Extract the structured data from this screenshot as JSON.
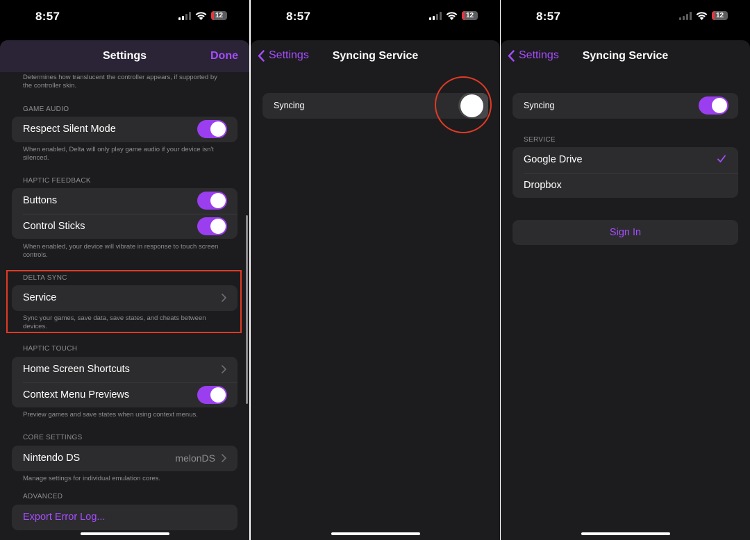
{
  "status": {
    "time": "8:57",
    "battery": "12"
  },
  "settings": {
    "title": "Settings",
    "done": "Done",
    "top_footer": "Determines how translucent the controller appears, if supported by the controller skin.",
    "sections": [
      {
        "label": "GAME AUDIO",
        "rows": [
          {
            "label": "Respect Silent Mode",
            "toggle": true
          }
        ],
        "footer": "When enabled, Delta will only play game audio if your device isn't silenced."
      },
      {
        "label": "HAPTIC FEEDBACK",
        "rows": [
          {
            "label": "Buttons",
            "toggle": true
          },
          {
            "label": "Control Sticks",
            "toggle": true
          }
        ],
        "footer": "When enabled, your device will vibrate in response to touch screen controls."
      },
      {
        "label": "DELTA SYNC",
        "rows": [
          {
            "label": "Service"
          }
        ],
        "footer": "Sync your games, save data, save states, and cheats between devices."
      },
      {
        "label": "HAPTIC TOUCH",
        "rows": [
          {
            "label": "Home Screen Shortcuts"
          },
          {
            "label": "Context Menu Previews",
            "toggle": true
          }
        ],
        "footer": "Preview games and save states when using context menus."
      },
      {
        "label": "CORE SETTINGS",
        "rows": [
          {
            "label": "Nintendo DS",
            "detail": "melonDS"
          }
        ],
        "footer": "Manage settings for individual emulation cores."
      },
      {
        "label": "ADVANCED",
        "rows": [
          {
            "label": "Export Error Log..."
          }
        ]
      }
    ]
  },
  "syncing_off": {
    "back": "Settings",
    "title": "Syncing Service",
    "syncing_label": "Syncing",
    "syncing_on": false
  },
  "syncing_on": {
    "back": "Settings",
    "title": "Syncing Service",
    "syncing_label": "Syncing",
    "syncing_on": true,
    "service_label": "SERVICE",
    "services": [
      {
        "label": "Google Drive",
        "selected": true
      },
      {
        "label": "Dropbox",
        "selected": false
      }
    ],
    "sign_in": "Sign In"
  },
  "colors": {
    "accent": "#a64dff",
    "highlight": "#e13a24",
    "background": "#000000",
    "cell": "#2c2c2e"
  }
}
